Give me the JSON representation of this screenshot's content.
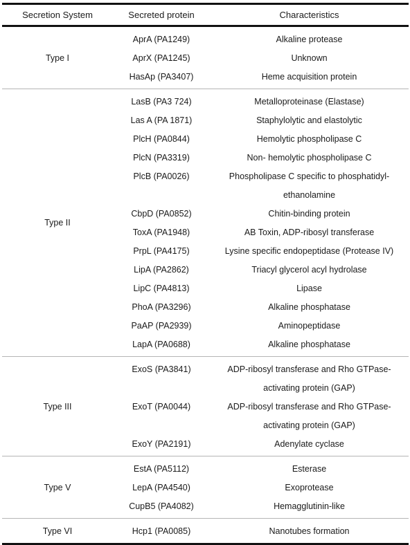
{
  "headers": {
    "secretion_system": "Secretion System",
    "secreted_protein": "Secreted protein",
    "characteristics": "Characteristics"
  },
  "groups": [
    {
      "system": "Type I",
      "rows": [
        {
          "protein": "AprA (PA1249)",
          "characteristics": [
            "Alkaline protease"
          ]
        },
        {
          "protein": "AprX (PA1245)",
          "characteristics": [
            "Unknown"
          ]
        },
        {
          "protein": "HasAp (PA3407)",
          "characteristics": [
            "Heme acquisition protein"
          ]
        }
      ]
    },
    {
      "system": "Type II",
      "rows": [
        {
          "protein": "LasB (PA3 724)",
          "characteristics": [
            "Metalloproteinase (Elastase)"
          ]
        },
        {
          "protein": "Las A (PA 1871)",
          "characteristics": [
            "Staphylolytic and elastolytic"
          ]
        },
        {
          "protein": "PlcH (PA0844)",
          "characteristics": [
            "Hemolytic phospholipase C"
          ]
        },
        {
          "protein": "PlcN (PA3319)",
          "characteristics": [
            "Non- hemolytic phospholipase C"
          ]
        },
        {
          "protein": "PlcB (PA0026)",
          "characteristics": [
            "Phospholipase C specific to phosphatidyl-",
            "ethanolamine"
          ]
        },
        {
          "protein": "CbpD (PA0852)",
          "characteristics": [
            "Chitin-binding protein"
          ]
        },
        {
          "protein": "ToxA (PA1948)",
          "characteristics": [
            "AB Toxin, ADP-ribosyl transferase"
          ]
        },
        {
          "protein": "PrpL (PA4175)",
          "characteristics": [
            "Lysine specific endopeptidase (Protease IV)"
          ]
        },
        {
          "protein": "LipA (PA2862)",
          "characteristics": [
            "Triacyl glycerol acyl hydrolase"
          ]
        },
        {
          "protein": "LipC (PA4813)",
          "characteristics": [
            "Lipase"
          ]
        },
        {
          "protein": "PhoA (PA3296)",
          "characteristics": [
            "Alkaline phosphatase"
          ]
        },
        {
          "protein": "PaAP (PA2939)",
          "characteristics": [
            "Aminopeptidase"
          ]
        },
        {
          "protein": "LapA (PA0688)",
          "characteristics": [
            "Alkaline phosphatase"
          ]
        }
      ]
    },
    {
      "system": "Type III",
      "rows": [
        {
          "protein": "ExoS (PA3841)",
          "characteristics": [
            "ADP-ribosyl transferase and Rho GTPase-",
            "activating protein (GAP)"
          ]
        },
        {
          "protein": "ExoT (PA0044)",
          "characteristics": [
            "ADP-ribosyl transferase and Rho GTPase-",
            "activating protein (GAP)"
          ]
        },
        {
          "protein": "ExoY (PA2191)",
          "characteristics": [
            "Adenylate cyclase"
          ]
        }
      ]
    },
    {
      "system": "Type V",
      "rows": [
        {
          "protein": "EstA (PA5112)",
          "characteristics": [
            "Esterase"
          ]
        },
        {
          "protein": "LepA (PA4540)",
          "characteristics": [
            "Exoprotease"
          ]
        },
        {
          "protein": "CupB5 (PA4082)",
          "characteristics": [
            "Hemagglutinin-like"
          ]
        }
      ]
    },
    {
      "system": "Type VI",
      "rows": [
        {
          "protein": "Hcp1 (PA0085)",
          "characteristics": [
            "Nanotubes formation"
          ]
        }
      ]
    }
  ]
}
